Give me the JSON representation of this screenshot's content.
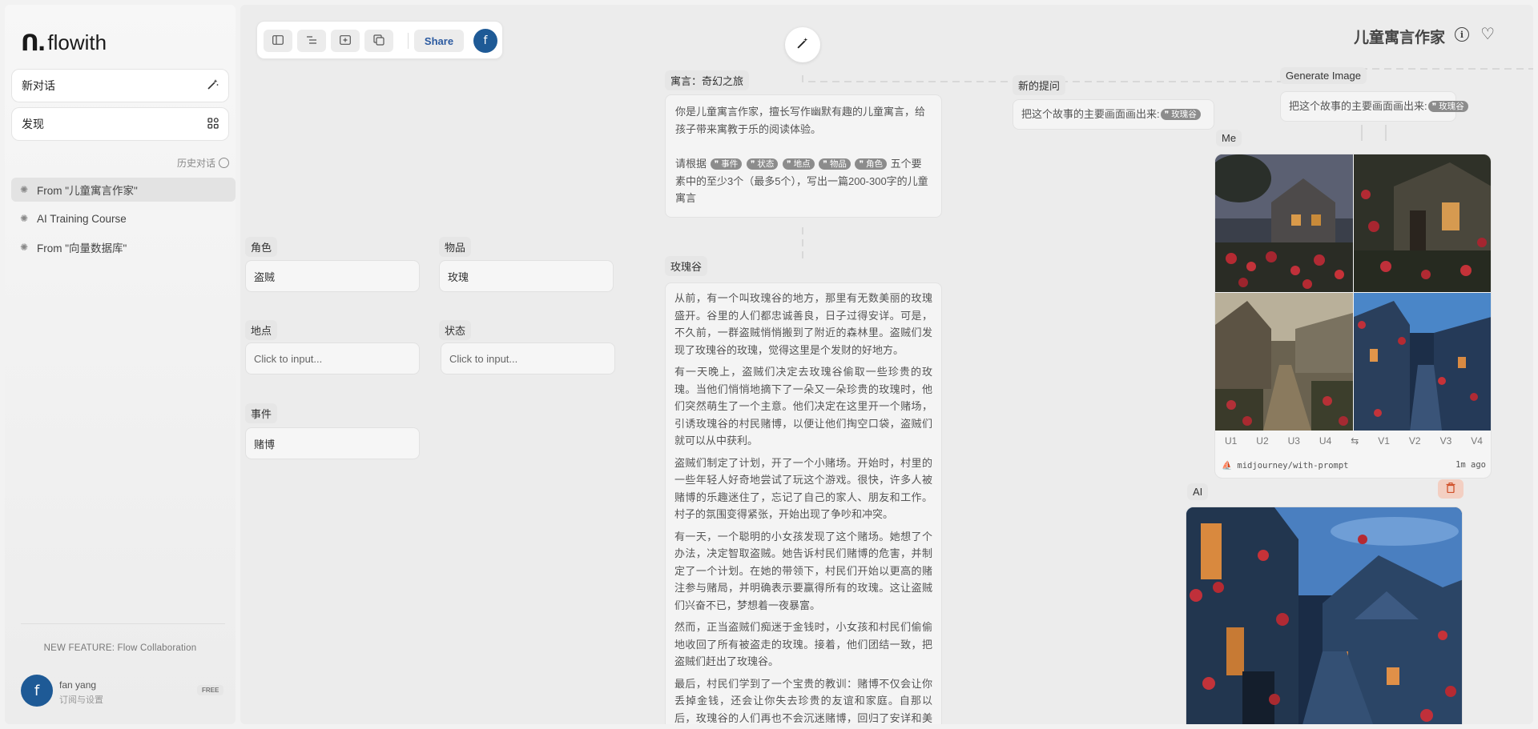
{
  "app": {
    "logo_mark": "ᑎ.",
    "logo_text": "flowith"
  },
  "sidebar": {
    "new_chat": "新对话",
    "new_chat_icon": "magic-wand-icon",
    "discover": "发现",
    "discover_icon": "grid-icon",
    "history_label": "历史对话",
    "history": [
      {
        "label": "From \"儿童寓言作家\"",
        "active": true
      },
      {
        "label": "AI Training Course",
        "active": false
      },
      {
        "label": "From \"向量数据库\"",
        "active": false
      }
    ],
    "feature_text": "NEW FEATURE: Flow Collaboration",
    "user": {
      "initial": "f",
      "name": "fan yang",
      "sub": "订阅与设置",
      "plan": "FREE"
    }
  },
  "toolbar": {
    "share": "Share",
    "avatar_initial": "f",
    "icons": [
      "sidebar-icon",
      "layout-icon",
      "add-frame-icon",
      "copy-icon"
    ]
  },
  "header": {
    "title": "儿童寓言作家"
  },
  "nodes": {
    "fable_label": "寓言：奇幻之旅",
    "fable_intro": "你是儿童寓言作家，擅长写作幽默有趣的儿童寓言，给孩子带来寓教于乐的阅读体验。",
    "fable_req_prefix": "请根据",
    "fable_chips": [
      "事件",
      "状态",
      "地点",
      "物品",
      "角色"
    ],
    "fable_req_suffix": "五个要素中的至少3个（最多5个），写出一篇200-300字的儿童寓言",
    "new_q_label": "新的提问",
    "new_q_text": "把这个故事的主要画面画出来:",
    "new_q_chip": "玫瑰谷",
    "gen_label": "Generate Image",
    "gen_text": "把这个故事的主要画面画出来:",
    "gen_chip": "玫瑰谷",
    "me_label": "Me",
    "ai_label": "AI",
    "story_label": "玫瑰谷",
    "story": [
      "从前，有一个叫玫瑰谷的地方，那里有无数美丽的玫瑰盛开。谷里的人们都忠诚善良，日子过得安详。可是，不久前，一群盗贼悄悄搬到了附近的森林里。盗贼们发现了玫瑰谷的玫瑰，觉得这里是个发财的好地方。",
      "有一天晚上，盗贼们决定去玫瑰谷偷取一些珍贵的玫瑰。当他们悄悄地摘下了一朵又一朵珍贵的玫瑰时，他们突然萌生了一个主意。他们决定在这里开一个赌场，引诱玫瑰谷的村民赌博，以便让他们掏空口袋，盗贼们就可以从中获利。",
      "盗贼们制定了计划，开了一个小赌场。开始时，村里的一些年轻人好奇地尝试了玩这个游戏。很快，许多人被赌博的乐趣迷住了，忘记了自己的家人、朋友和工作。村子的氛围变得紧张，开始出现了争吵和冲突。",
      "有一天，一个聪明的小女孩发现了这个赌场。她想了个办法，决定智取盗贼。她告诉村民们赌博的危害，并制定了一个计划。在她的带领下，村民们开始以更高的赌注参与赌局，并明确表示要赢得所有的玫瑰。这让盗贼们兴奋不已，梦想着一夜暴富。",
      "然而，正当盗贼们痴迷于金钱时，小女孩和村民们偷偷地收回了所有被盗走的玫瑰。接着，他们团结一致，把盗贼们赶出了玫瑰谷。",
      "最后，村民们学到了一个宝贵的教训：赌博不仅会让你丢掉金钱，还会让你失去珍贵的友谊和家庭。自那以后，玫瑰谷的人们再也不会沉迷赌博，回归了安详和美好的生活。"
    ]
  },
  "fields": {
    "role": {
      "label": "角色",
      "value": "盗贼"
    },
    "item": {
      "label": "物品",
      "value": "玫瑰"
    },
    "place": {
      "label": "地点",
      "value": "Click to input..."
    },
    "state": {
      "label": "状态",
      "value": "Click to input..."
    },
    "event": {
      "label": "事件",
      "value": "赌博"
    }
  },
  "image_result": {
    "buttons": [
      "U1",
      "U2",
      "U3",
      "U4",
      "⇆",
      "V1",
      "V2",
      "V3",
      "V4"
    ],
    "model": "midjourney/with-prompt",
    "time": "1m ago"
  },
  "colors": {
    "accent": "#1e5a96",
    "trash_bg": "#f3cfc2",
    "trash_fg": "#d0502a"
  }
}
